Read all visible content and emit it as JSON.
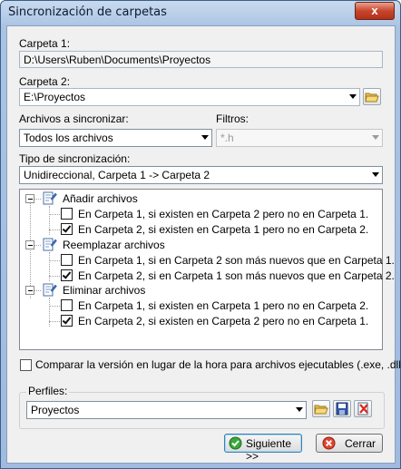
{
  "window": {
    "title": "Sincronización de carpetas",
    "close_glyph": "x"
  },
  "folder1": {
    "label": "Carpeta 1:",
    "value": "D:\\Users\\Ruben\\Documents\\Proyectos"
  },
  "folder2": {
    "label": "Carpeta 2:",
    "value": "E:\\Proyectos"
  },
  "files": {
    "label": "Archivos a sincronizar:",
    "selected": "Todos los archivos"
  },
  "filters": {
    "label": "Filtros:",
    "value": "*.h"
  },
  "sync_type": {
    "label": "Tipo de sincronización:",
    "selected": "Unidireccional, Carpeta 1 -> Carpeta 2"
  },
  "tree": {
    "groups": [
      {
        "label": "Añadir archivos",
        "items": [
          {
            "label": "En Carpeta 1, si existen en Carpeta 2 pero no en Carpeta 1.",
            "checked": false
          },
          {
            "label": "En Carpeta 2, si existen en Carpeta 1 pero no en Carpeta 2.",
            "checked": true
          }
        ]
      },
      {
        "label": "Reemplazar archivos",
        "items": [
          {
            "label": "En Carpeta 1, si en Carpeta 2 son más nuevos que en Carpeta 1.",
            "checked": false
          },
          {
            "label": "En Carpeta 2, si en Carpeta 1 son más nuevos que en Carpeta 2.",
            "checked": true
          }
        ]
      },
      {
        "label": "Eliminar archivos",
        "items": [
          {
            "label": "En Carpeta 1, si existen en Carpeta 1 pero no en Carpeta 2.",
            "checked": false
          },
          {
            "label": "En Carpeta 2, si existen en Carpeta 2 pero no en Carpeta 1.",
            "checked": true
          }
        ]
      }
    ]
  },
  "compare": {
    "label": "Comparar la versión en lugar de la hora para archivos ejecutables (.exe, .dll, etc.)",
    "checked": false
  },
  "profiles": {
    "label": "Perfiles:",
    "selected": "Proyectos"
  },
  "buttons": {
    "next": "Siguiente >>",
    "close": "Cerrar"
  },
  "colors": {
    "title_bar": "#a9c3e3",
    "close_button": "#c7462c",
    "checked": "#111111"
  }
}
